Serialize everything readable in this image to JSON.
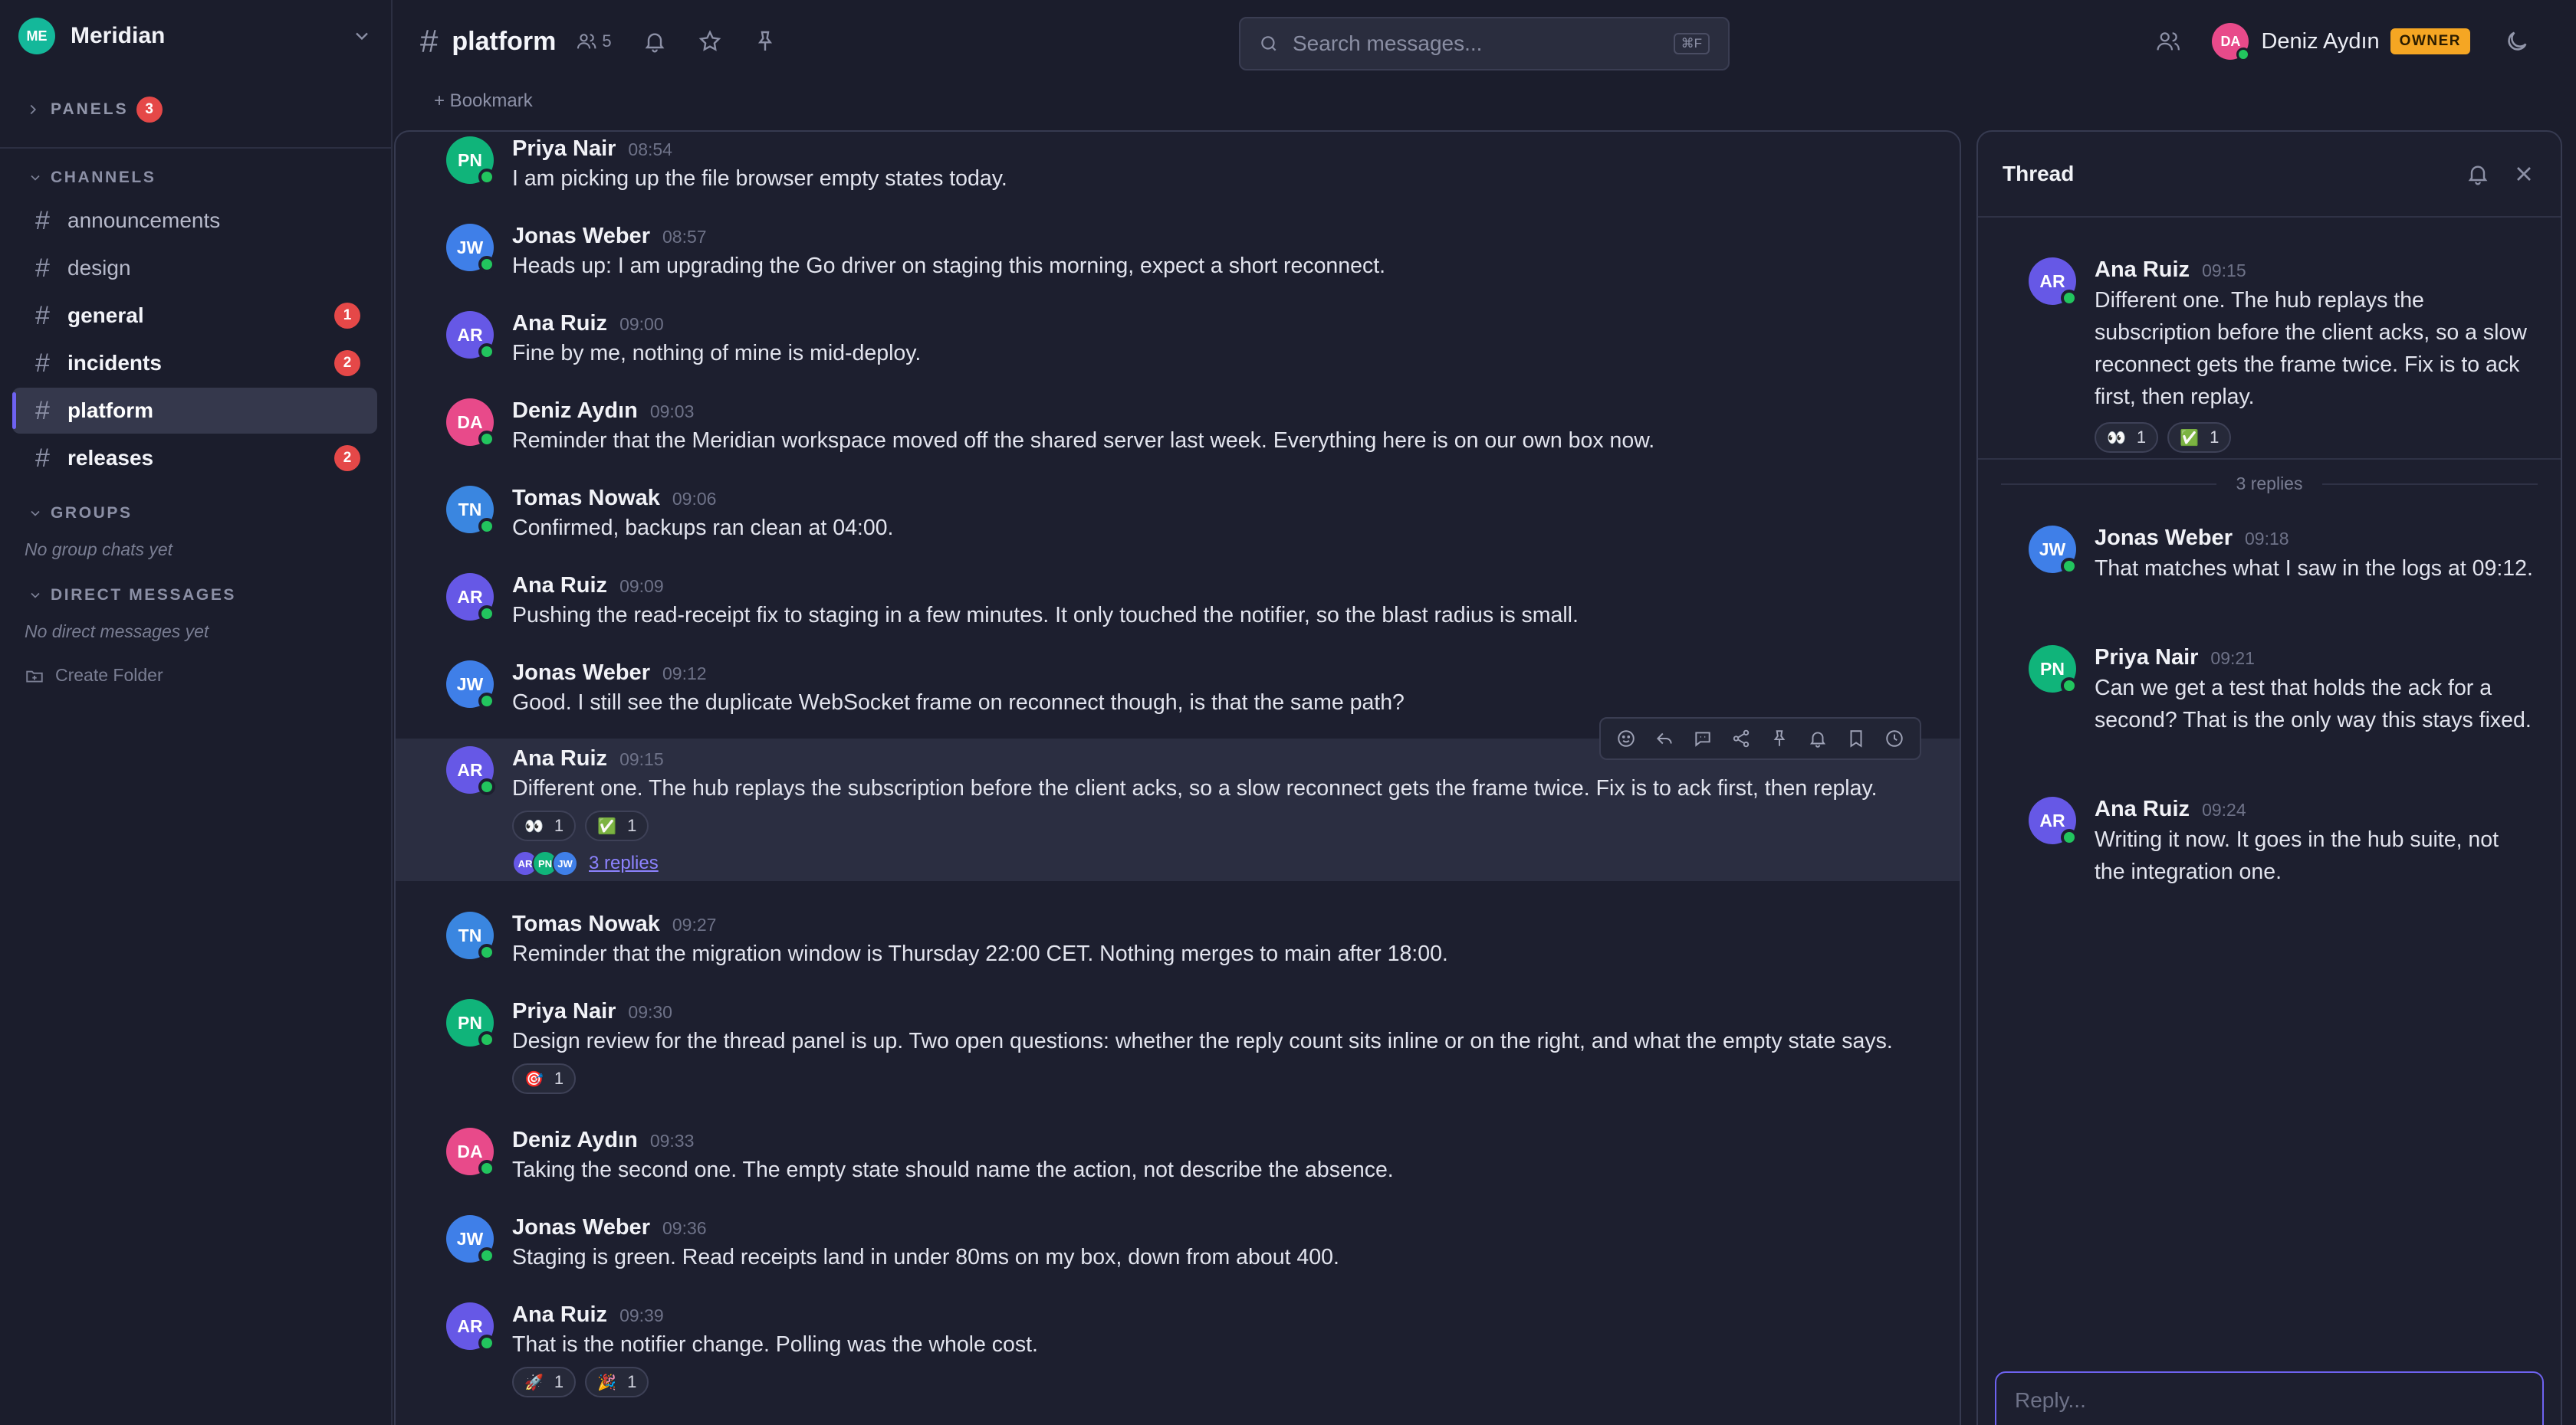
{
  "workspace": {
    "initials": "ME",
    "name": "Meridian"
  },
  "sidebar": {
    "panels_label": "PANELS",
    "panels_count": "3",
    "channels_label": "CHANNELS",
    "channels": [
      {
        "name": "announcements",
        "badge": ""
      },
      {
        "name": "design",
        "badge": ""
      },
      {
        "name": "general",
        "badge": "1"
      },
      {
        "name": "incidents",
        "badge": "2"
      },
      {
        "name": "platform",
        "badge": ""
      },
      {
        "name": "releases",
        "badge": "2"
      }
    ],
    "groups_label": "GROUPS",
    "groups_empty": "No group chats yet",
    "dm_label": "DIRECT MESSAGES",
    "dm_empty": "No direct messages yet",
    "create_folder": "Create Folder"
  },
  "header": {
    "channel": "platform",
    "member_count": "5",
    "bookmark": "+ Bookmark",
    "search_placeholder": "Search messages...",
    "search_shortcut": "⌘F",
    "user_initials": "DA",
    "user_name": "Deniz Aydın",
    "role": "OWNER"
  },
  "colors": {
    "accent": "#6e62f0",
    "online": "#22c55e",
    "unread_badge": "#e54848",
    "owner_badge": "#f5a623"
  },
  "messages": [
    {
      "initials": "PN",
      "author": "Priya Nair",
      "time": "08:54",
      "text": "I am picking up the file browser empty states today."
    },
    {
      "initials": "JW",
      "author": "Jonas Weber",
      "time": "08:57",
      "text": "Heads up: I am upgrading the Go driver on staging this morning, expect a short reconnect."
    },
    {
      "initials": "AR",
      "author": "Ana Ruiz",
      "time": "09:00",
      "text": "Fine by me, nothing of mine is mid-deploy."
    },
    {
      "initials": "DA",
      "author": "Deniz Aydın",
      "time": "09:03",
      "text": "Reminder that the Meridian workspace moved off the shared server last week. Everything here is on our own box now."
    },
    {
      "initials": "TN",
      "author": "Tomas Nowak",
      "time": "09:06",
      "text": "Confirmed, backups ran clean at 04:00."
    },
    {
      "initials": "AR",
      "author": "Ana Ruiz",
      "time": "09:09",
      "text": "Pushing the read-receipt fix to staging in a few minutes. It only touched the notifier, so the blast radius is small."
    },
    {
      "initials": "JW",
      "author": "Jonas Weber",
      "time": "09:12",
      "text": "Good. I still see the duplicate WebSocket frame on reconnect though, is that the same path?"
    },
    {
      "initials": "AR",
      "author": "Ana Ruiz",
      "time": "09:15",
      "text": "Different one. The hub replays the subscription before the client acks, so a slow reconnect gets the frame twice. Fix is to ack first, then replay.",
      "reactions": [
        {
          "emoji": "👀",
          "count": "1"
        },
        {
          "emoji": "✅",
          "count": "1"
        }
      ],
      "reply_avatars": [
        "AR",
        "PN",
        "JW"
      ],
      "replies": "3 replies"
    },
    {
      "initials": "TN",
      "author": "Tomas Nowak",
      "time": "09:27",
      "text": "Reminder that the migration window is Thursday 22:00 CET. Nothing merges to main after 18:00."
    },
    {
      "initials": "PN",
      "author": "Priya Nair",
      "time": "09:30",
      "text": "Design review for the thread panel is up. Two open questions: whether the reply count sits inline or on the right, and what the empty state says.",
      "reactions": [
        {
          "emoji": "🎯",
          "count": "1"
        }
      ]
    },
    {
      "initials": "DA",
      "author": "Deniz Aydın",
      "time": "09:33",
      "text": "Taking the second one. The empty state should name the action, not describe the absence."
    },
    {
      "initials": "JW",
      "author": "Jonas Weber",
      "time": "09:36",
      "text": "Staging is green. Read receipts land in under 80ms on my box, down from about 400."
    },
    {
      "initials": "AR",
      "author": "Ana Ruiz",
      "time": "09:39",
      "text": "That is the notifier change. Polling was the whole cost.",
      "reactions": [
        {
          "emoji": "🚀",
          "count": "1"
        },
        {
          "emoji": "🎉",
          "count": "1"
        }
      ]
    }
  ],
  "thread": {
    "title": "Thread",
    "root": {
      "initials": "AR",
      "author": "Ana Ruiz",
      "time": "09:15",
      "text": "Different one. The hub replays the subscription before the client acks, so a slow reconnect gets the frame twice. Fix is to ack first, then replay.",
      "reactions": [
        {
          "emoji": "👀",
          "count": "1"
        },
        {
          "emoji": "✅",
          "count": "1"
        }
      ]
    },
    "divider": "3 replies",
    "replies": [
      {
        "initials": "JW",
        "author": "Jonas Weber",
        "time": "09:18",
        "text": "That matches what I saw in the logs at 09:12."
      },
      {
        "initials": "PN",
        "author": "Priya Nair",
        "time": "09:21",
        "text": "Can we get a test that holds the ack for a second? That is the only way this stays fixed."
      },
      {
        "initials": "AR",
        "author": "Ana Ruiz",
        "time": "09:24",
        "text": "Writing it now. It goes in the hub suite, not the integration one."
      }
    ],
    "reply_placeholder": "Reply..."
  }
}
